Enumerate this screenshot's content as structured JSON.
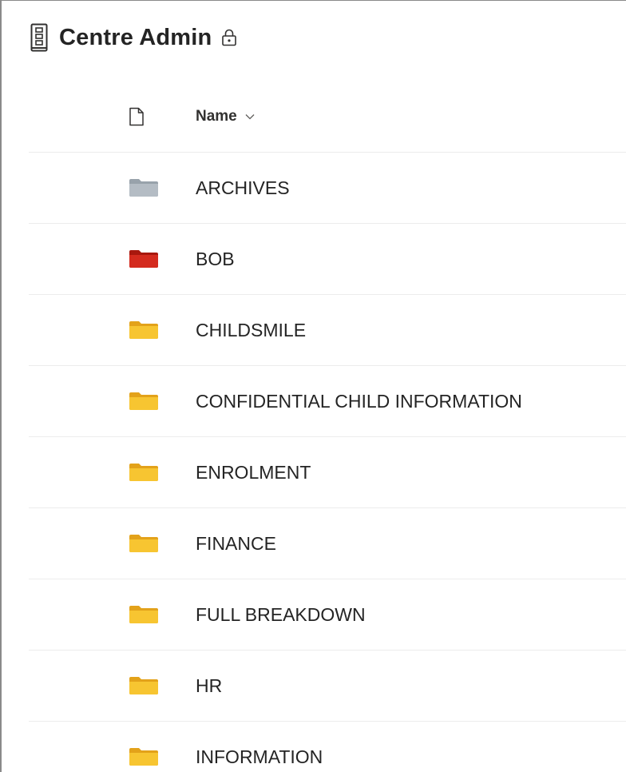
{
  "library": {
    "title": "Centre Admin",
    "icon": "document-library-icon",
    "lock_icon": "lock-icon"
  },
  "list": {
    "header": {
      "file_type_icon": "file-icon",
      "name_label": "Name",
      "sort_icon": "chevron-down-icon"
    },
    "items": [
      {
        "name": "ARCHIVES",
        "folder_color": "#b4bcc4"
      },
      {
        "name": "BOB",
        "folder_color": "#d42b1e"
      },
      {
        "name": "CHILDSMILE",
        "folder_color": "#f7c531"
      },
      {
        "name": "CONFIDENTIAL CHILD INFORMATION",
        "folder_color": "#f7c531"
      },
      {
        "name": "ENROLMENT",
        "folder_color": "#f7c531"
      },
      {
        "name": "FINANCE",
        "folder_color": "#f7c531"
      },
      {
        "name": "FULL BREAKDOWN",
        "folder_color": "#f7c531"
      },
      {
        "name": "HR",
        "folder_color": "#f7c531"
      },
      {
        "name": "INFORMATION",
        "folder_color": "#f7c531"
      }
    ]
  }
}
